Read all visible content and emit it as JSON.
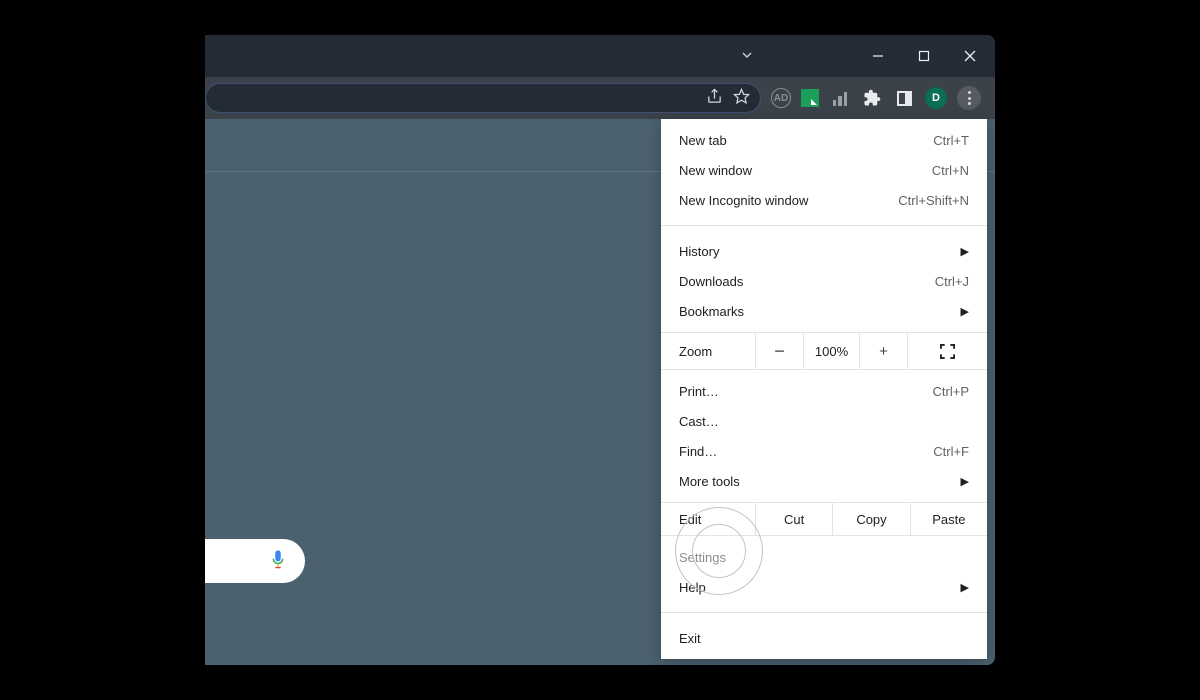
{
  "avatar_letter": "D",
  "zoom": {
    "label": "Zoom",
    "value": "100%"
  },
  "edit": {
    "label": "Edit",
    "cut": "Cut",
    "copy": "Copy",
    "paste": "Paste"
  },
  "menu_block1": [
    {
      "label": "New tab",
      "shortcut": "Ctrl+T",
      "submenu": false
    },
    {
      "label": "New window",
      "shortcut": "Ctrl+N",
      "submenu": false
    },
    {
      "label": "New Incognito window",
      "shortcut": "Ctrl+Shift+N",
      "submenu": false
    }
  ],
  "menu_block2": [
    {
      "label": "History",
      "shortcut": "",
      "submenu": true
    },
    {
      "label": "Downloads",
      "shortcut": "Ctrl+J",
      "submenu": false
    },
    {
      "label": "Bookmarks",
      "shortcut": "",
      "submenu": true
    }
  ],
  "menu_block3": [
    {
      "label": "Print…",
      "shortcut": "Ctrl+P",
      "submenu": false
    },
    {
      "label": "Cast…",
      "shortcut": "",
      "submenu": false
    },
    {
      "label": "Find…",
      "shortcut": "Ctrl+F",
      "submenu": false
    },
    {
      "label": "More tools",
      "shortcut": "",
      "submenu": true
    }
  ],
  "menu_block4": [
    {
      "label": "Settings",
      "shortcut": "",
      "submenu": false
    },
    {
      "label": "Help",
      "shortcut": "",
      "submenu": true
    }
  ],
  "menu_block5": [
    {
      "label": "Exit",
      "shortcut": "",
      "submenu": false
    }
  ]
}
